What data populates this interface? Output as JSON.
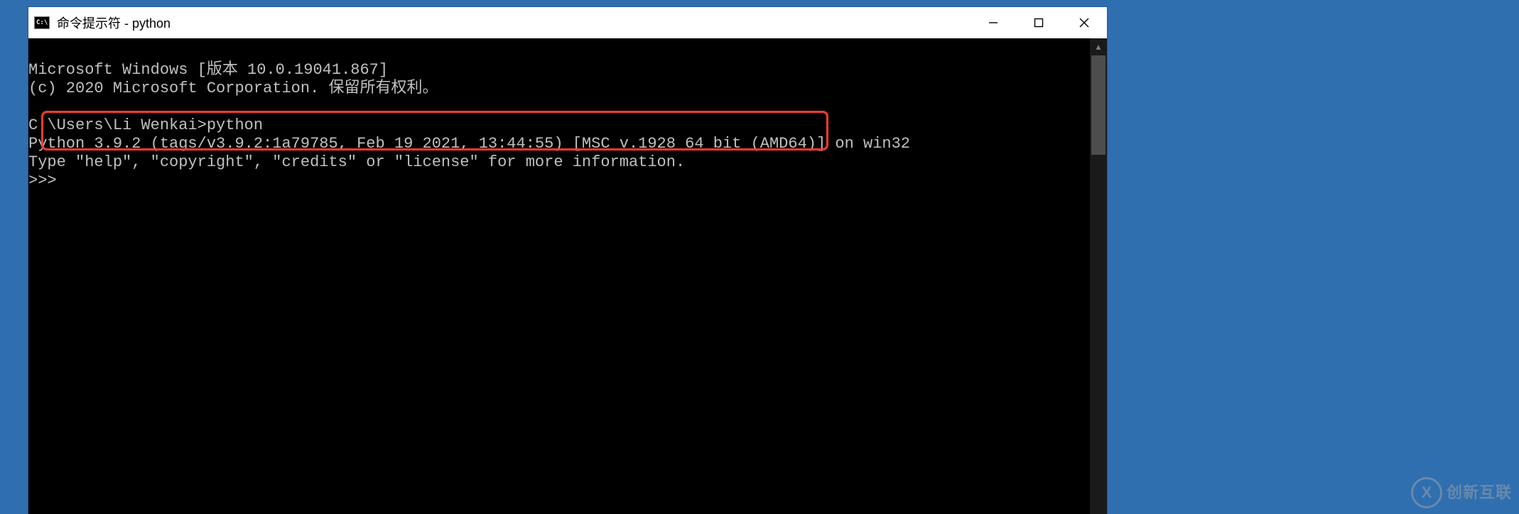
{
  "window": {
    "title": "命令提示符 - python"
  },
  "terminal": {
    "lines": {
      "l0": "Microsoft Windows [版本 10.0.19041.867]",
      "l1": "(c) 2020 Microsoft Corporation. 保留所有权利。",
      "l2": "C:\\Users\\Li Wenkai>python",
      "l3": "Python 3.9.2 (tags/v3.9.2:1a79785, Feb 19 2021, 13:44:55) [MSC v.1928 64 bit (AMD64)] on win32",
      "l4": "Type \"help\", \"copyright\", \"credits\" or \"license\" for more information.",
      "l5": ">>>"
    }
  },
  "watermark": {
    "badge": "X",
    "text": "创新互联"
  }
}
